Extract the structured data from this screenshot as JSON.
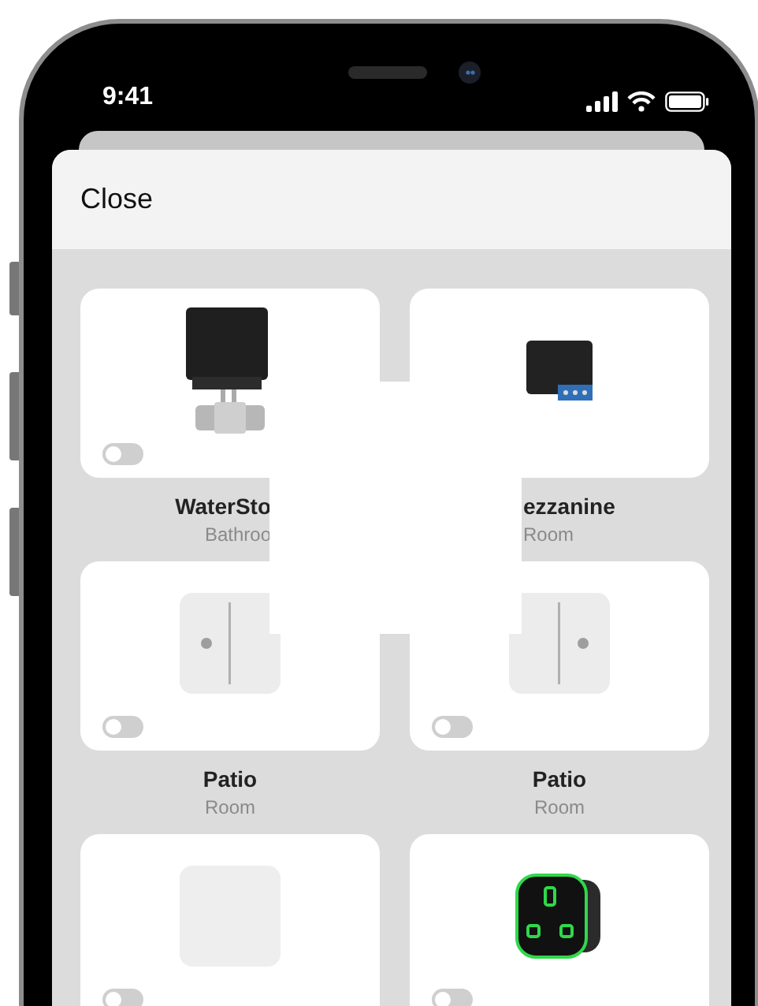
{
  "status_bar": {
    "time": "9:41"
  },
  "sheet": {
    "close_label": "Close"
  },
  "devices": [
    {
      "kind": "valve",
      "name": "WaterSto",
      "room": "Bathroo",
      "on": false
    },
    {
      "kind": "relay",
      "name": "ezzanine",
      "room": "Room"
    },
    {
      "kind": "door_sensor_left",
      "name": "Patio",
      "room": "Room",
      "on": false
    },
    {
      "kind": "door_sensor_right",
      "name": "Patio",
      "room": "Room",
      "on": false
    },
    {
      "kind": "panel",
      "on": false
    },
    {
      "kind": "socket",
      "on": false
    }
  ]
}
